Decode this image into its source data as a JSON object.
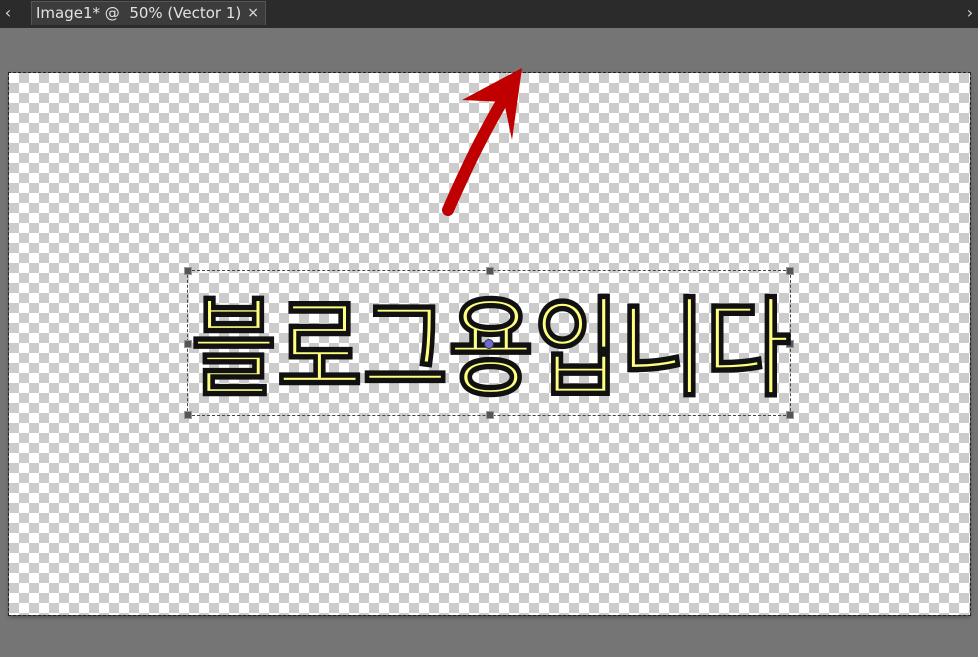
{
  "tabbar": {
    "prev_label": "‹",
    "next_label": "›",
    "tab": {
      "title": "Image1* @  50% (Vector 1)",
      "close_label": "×"
    }
  },
  "canvas": {
    "text": "블로그용입니다",
    "text_fill": "#ffff80",
    "text_stroke": "#111111",
    "arrow_color": "#c00000"
  }
}
